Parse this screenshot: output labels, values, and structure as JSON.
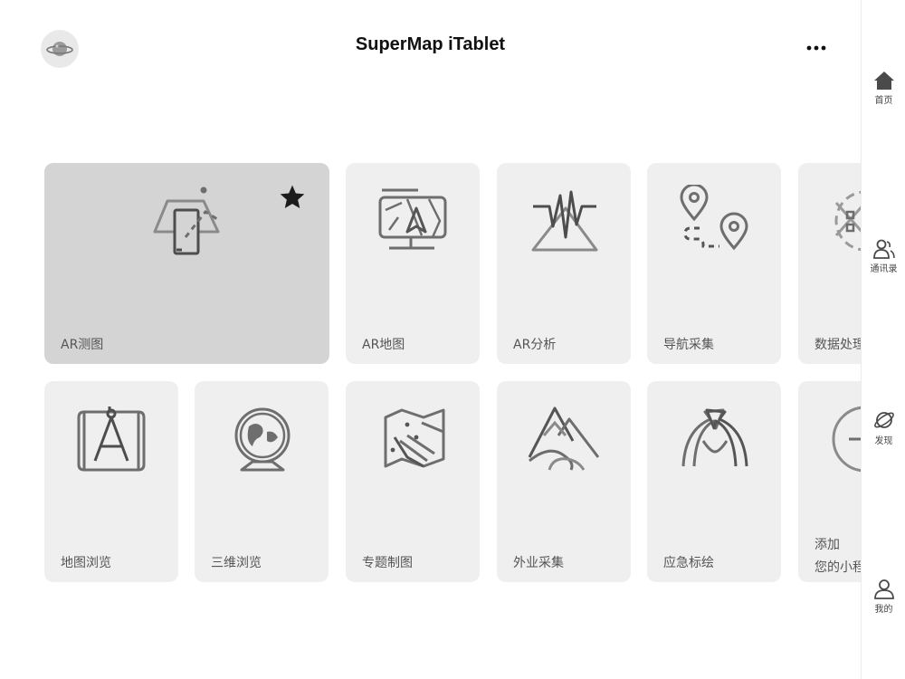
{
  "app": {
    "title": "SuperMap iTablet"
  },
  "header": {
    "avatar_icon": "planet-icon",
    "more_icon": "more-dots-icon"
  },
  "tiles": [
    {
      "label": "AR测图",
      "icon": "ar-measure-icon",
      "favorite": true
    },
    {
      "label": "AR地图",
      "icon": "ar-map-icon"
    },
    {
      "label": "AR分析",
      "icon": "ar-analysis-icon"
    },
    {
      "label": "导航采集",
      "icon": "navigation-collect-icon"
    },
    {
      "label": "数据处理",
      "icon": "data-processing-icon"
    },
    {
      "label": "地图浏览",
      "icon": "map-browse-icon"
    },
    {
      "label": "三维浏览",
      "icon": "globe-3d-icon"
    },
    {
      "label": "专题制图",
      "icon": "thematic-map-icon"
    },
    {
      "label": "外业采集",
      "icon": "field-collect-icon"
    },
    {
      "label": "应急标绘",
      "icon": "emergency-plot-icon"
    },
    {
      "label": "添加",
      "label2": "您的小程序",
      "icon": "add-icon"
    }
  ],
  "sidebar": {
    "items": [
      {
        "label": "首页",
        "icon": "home-icon"
      },
      {
        "label": "通讯录",
        "icon": "contacts-icon"
      },
      {
        "label": "发现",
        "icon": "discover-planet-icon"
      },
      {
        "label": "我的",
        "icon": "profile-icon"
      }
    ]
  },
  "colors": {
    "tile_bg": "#efefef",
    "featured_tile_bg": "#d4d4d4",
    "icon_stroke": "#6e6e6e",
    "text": "#555555"
  }
}
